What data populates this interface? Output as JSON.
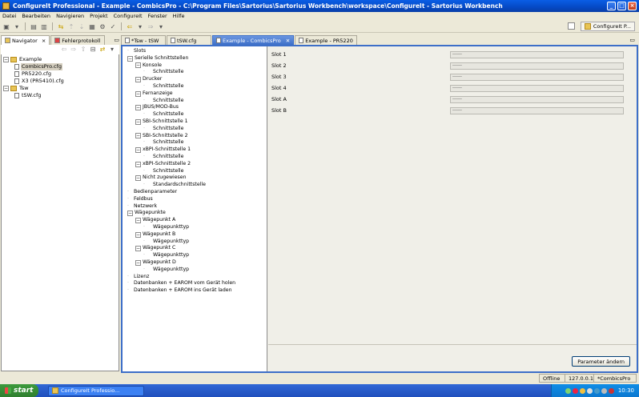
{
  "window": {
    "title": "ConfigureIt Professional - Example - CombicsPro - C:\\Program Files\\Sartorius\\Sartorius Workbench\\workspace\\ConfigureIt - Sartorius Workbench",
    "buttons": {
      "minimize": "_",
      "maximize": "□",
      "close": "×"
    }
  },
  "menubar": [
    "Datei",
    "Bearbeiten",
    "Navigieren",
    "Projekt",
    "ConfigureIt",
    "Fenster",
    "Hilfe"
  ],
  "perspective": {
    "label": "ConfigureIt P..."
  },
  "navigator": {
    "tabs": [
      {
        "label": "Navigator",
        "active": true
      },
      {
        "label": "Fehlerprotokoll",
        "active": false
      }
    ],
    "tree": [
      {
        "level": 0,
        "type": "folder",
        "label": "Example",
        "expanded": true
      },
      {
        "level": 1,
        "type": "file",
        "label": "CombicsPro.cfg",
        "selected": true
      },
      {
        "level": 1,
        "type": "file",
        "label": "PR5220.cfg"
      },
      {
        "level": 1,
        "type": "file",
        "label": "X3 (PR5410).cfg"
      },
      {
        "level": 0,
        "type": "folder",
        "label": "Tsw",
        "expanded": true
      },
      {
        "level": 1,
        "type": "file",
        "label": "tSW.cfg"
      }
    ]
  },
  "editor": {
    "tabs": [
      {
        "label": "*Tsw - tSW",
        "active": false
      },
      {
        "label": "tSW.cfg",
        "active": false
      },
      {
        "label": "Example - CombicsPro",
        "active": true
      },
      {
        "label": "Example - PR5220",
        "active": false
      }
    ],
    "tree": [
      {
        "level": 0,
        "label": "Slots"
      },
      {
        "level": 0,
        "label": "Serielle Schnittstellen",
        "exp": "-"
      },
      {
        "level": 1,
        "label": "Konsole",
        "exp": "-"
      },
      {
        "level": 2,
        "label": "Schnittstelle"
      },
      {
        "level": 1,
        "label": "Drucker",
        "exp": "-"
      },
      {
        "level": 2,
        "label": "Schnittstelle"
      },
      {
        "level": 1,
        "label": "Fernanzeige",
        "exp": "-"
      },
      {
        "level": 2,
        "label": "Schnittstelle"
      },
      {
        "level": 1,
        "label": "JBUS/MOD-Bus",
        "exp": "-"
      },
      {
        "level": 2,
        "label": "Schnittstelle"
      },
      {
        "level": 1,
        "label": "SBI-Schnittstelle 1",
        "exp": "-"
      },
      {
        "level": 2,
        "label": "Schnittstelle"
      },
      {
        "level": 1,
        "label": "SBI-Schnittstelle 2",
        "exp": "-"
      },
      {
        "level": 2,
        "label": "Schnittstelle"
      },
      {
        "level": 1,
        "label": "xBPI-Schnittstelle 1",
        "exp": "-"
      },
      {
        "level": 2,
        "label": "Schnittstelle"
      },
      {
        "level": 1,
        "label": "xBPI-Schnittstelle 2",
        "exp": "-"
      },
      {
        "level": 2,
        "label": "Schnittstelle"
      },
      {
        "level": 1,
        "label": "Nicht zugewiesen",
        "exp": "-"
      },
      {
        "level": 2,
        "label": "Standardschnittstelle"
      },
      {
        "level": 0,
        "label": "Bedienparameter"
      },
      {
        "level": 0,
        "label": "Feldbus"
      },
      {
        "level": 0,
        "label": "Netzwerk"
      },
      {
        "level": 0,
        "label": "Wägepunkte",
        "exp": "-"
      },
      {
        "level": 1,
        "label": "Wägepunkt A",
        "exp": "-"
      },
      {
        "level": 2,
        "label": "Wägepunkttyp"
      },
      {
        "level": 1,
        "label": "Wägepunkt B",
        "exp": "-"
      },
      {
        "level": 2,
        "label": "Wägepunkttyp"
      },
      {
        "level": 1,
        "label": "Wägepunkt C",
        "exp": "-"
      },
      {
        "level": 2,
        "label": "Wägepunkttyp"
      },
      {
        "level": 1,
        "label": "Wägepunkt D",
        "exp": "-"
      },
      {
        "level": 2,
        "label": "Wägepunkttyp"
      },
      {
        "level": 0,
        "label": "Lizenz"
      },
      {
        "level": 0,
        "label": "Datenbanken + EAROM vom Gerät holen"
      },
      {
        "level": 0,
        "label": "Datenbanken + EAROM ins Gerät laden"
      }
    ],
    "slots": [
      {
        "label": "Slot 1",
        "value": "------"
      },
      {
        "label": "Slot 2",
        "value": "------"
      },
      {
        "label": "Slot 3",
        "value": "------"
      },
      {
        "label": "Slot 4",
        "value": "------"
      },
      {
        "label": "Slot A",
        "value": "------"
      },
      {
        "label": "Slot B",
        "value": "------"
      }
    ],
    "parameter_button": "Parameter ändern"
  },
  "statusbar": {
    "mode": "Offline",
    "ip": "127.0.0.1",
    "device": "*CombicsPro"
  },
  "taskbar": {
    "start": "start",
    "task": "ConfigureIt Professio...",
    "clock": "10:30"
  },
  "colors": {
    "title_blue": "#0549c4",
    "editor_active_tab": "#3d6fc8",
    "taskbar_blue": "#2455c3",
    "start_green": "#3c9a3c"
  }
}
